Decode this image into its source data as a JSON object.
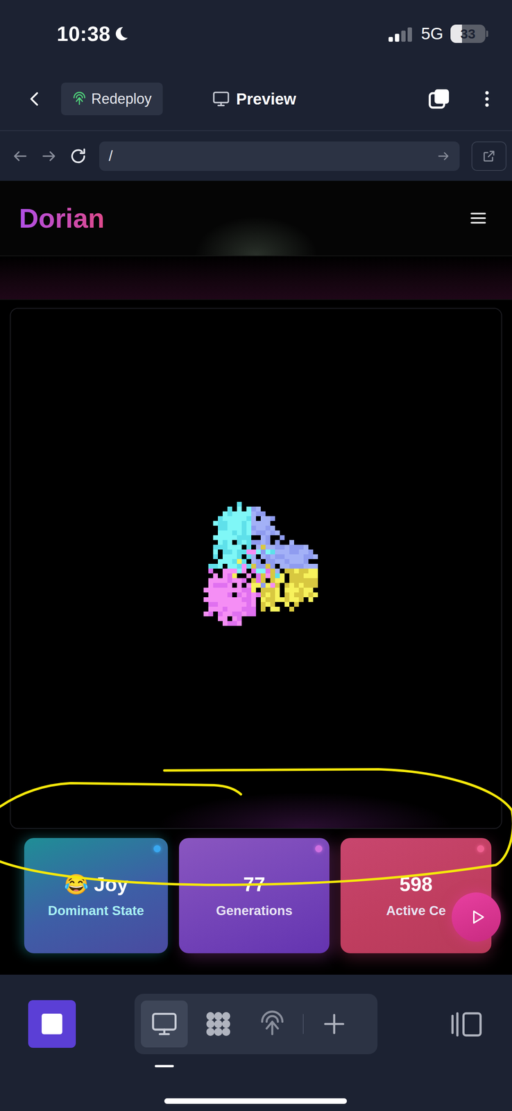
{
  "status_bar": {
    "time": "10:38",
    "network": "5G",
    "battery": "33",
    "battery_level": 0.33,
    "signal_level": 0.5
  },
  "toolbar": {
    "redeploy": "Redeploy",
    "title": "Preview"
  },
  "browser": {
    "url": "/"
  },
  "site": {
    "logo": "Dorian"
  },
  "stats": [
    {
      "value": "😂 Joy",
      "label": "Dominant State",
      "color": "#3aa8f0"
    },
    {
      "value": "77",
      "label": "Generations",
      "color": "#d070e0"
    },
    {
      "value": "598",
      "label": "Active Ce",
      "color": "#f06090"
    }
  ],
  "bottom_tabs": [
    {
      "kind": "monitor",
      "selected": true
    },
    {
      "kind": "blob",
      "selected": false
    },
    {
      "kind": "antenna",
      "selected": false
    },
    {
      "kind": "plus",
      "selected": false
    }
  ]
}
